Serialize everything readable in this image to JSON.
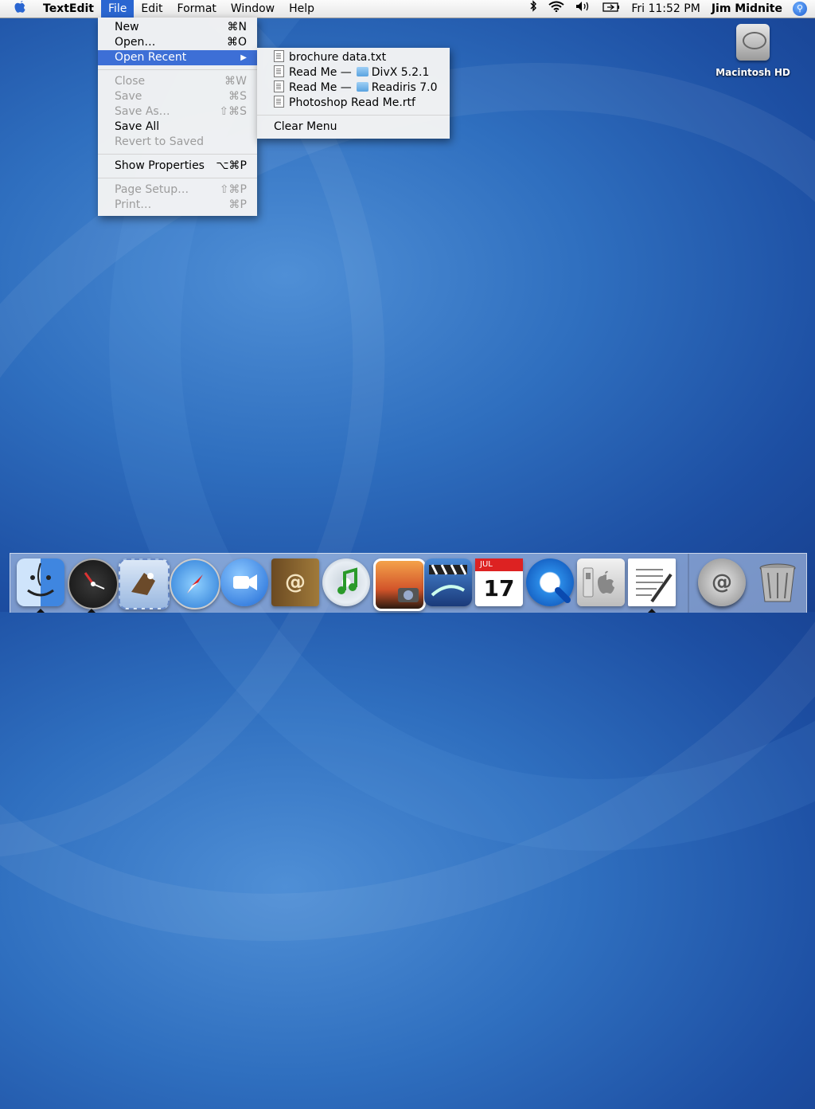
{
  "menubar": {
    "app_name": "TextEdit",
    "menus": [
      "File",
      "Edit",
      "Format",
      "Window",
      "Help"
    ],
    "clock": "Fri 11:52 PM",
    "user": "Jim Midnite"
  },
  "file_menu": {
    "new": {
      "label": "New",
      "shortcut": "⌘N"
    },
    "open": {
      "label": "Open…",
      "shortcut": "⌘O"
    },
    "open_recent": {
      "label": "Open Recent"
    },
    "close": {
      "label": "Close",
      "shortcut": "⌘W"
    },
    "save": {
      "label": "Save",
      "shortcut": "⌘S"
    },
    "save_as": {
      "label": "Save As…",
      "shortcut": "⇧⌘S"
    },
    "save_all": {
      "label": "Save All"
    },
    "revert": {
      "label": "Revert to Saved"
    },
    "show_properties": {
      "label": "Show Properties",
      "shortcut": "⌥⌘P"
    },
    "page_setup": {
      "label": "Page Setup…",
      "shortcut": "⇧⌘P"
    },
    "print": {
      "label": "Print…",
      "shortcut": "⌘P"
    }
  },
  "recent_menu": {
    "item1": "brochure data.txt",
    "item2_prefix": "Read Me —",
    "item2_folder": "DivX 5.2.1",
    "item3_prefix": "Read Me —",
    "item3_folder": "Readiris 7.0",
    "item4": "Photoshop Read Me.rtf",
    "clear": "Clear Menu"
  },
  "desktop": {
    "hd_label": "Macintosh HD"
  },
  "dock": {
    "icons": [
      "finder-icon",
      "dashboard-icon",
      "mail-icon",
      "safari-icon",
      "ichat-icon",
      "address-book-icon",
      "itunes-icon",
      "iphoto-icon",
      "imovie-icon",
      "ical-icon",
      "quicktime-icon",
      "system-preferences-icon",
      "textedit-icon",
      "mail-server-icon",
      "trash-icon"
    ],
    "ical_month": "JUL",
    "ical_day": "17",
    "accent_blue": "#2a66d1"
  }
}
